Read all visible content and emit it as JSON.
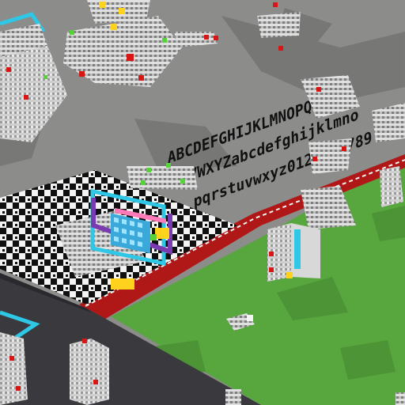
{
  "scene": {
    "view": "isometric voxel world",
    "colors": {
      "gray_ground": "#8c8c8a",
      "gray_shadow": "#6f6f6d",
      "grass": "#58a63e",
      "grass_dark": "#4c9436",
      "red_border": "#b01818",
      "white_border": "#f2f2f2",
      "road": "#3a3a3e",
      "checker_black": "#101010",
      "checker_white": "#f4f4f4",
      "cyan_frame": "#2ec8e6",
      "purple_frame": "#7a3bb0",
      "pink_bar": "#ff7ab8",
      "yellow": "#ffd21e",
      "red_voxel": "#d81616",
      "green_voxel": "#58d23a"
    }
  },
  "floor_text": {
    "line1": "ABCDEFGHIJKLMNOPQRST",
    "line2": "UVWXYZabcdefghijklmno",
    "line3": "pqrstuvwxyz0123456789"
  },
  "objects": {
    "machine": "pixel-art machine with cyan frame",
    "towers": [
      "white voxel tower",
      "white voxel tower",
      "white voxel tower"
    ]
  }
}
